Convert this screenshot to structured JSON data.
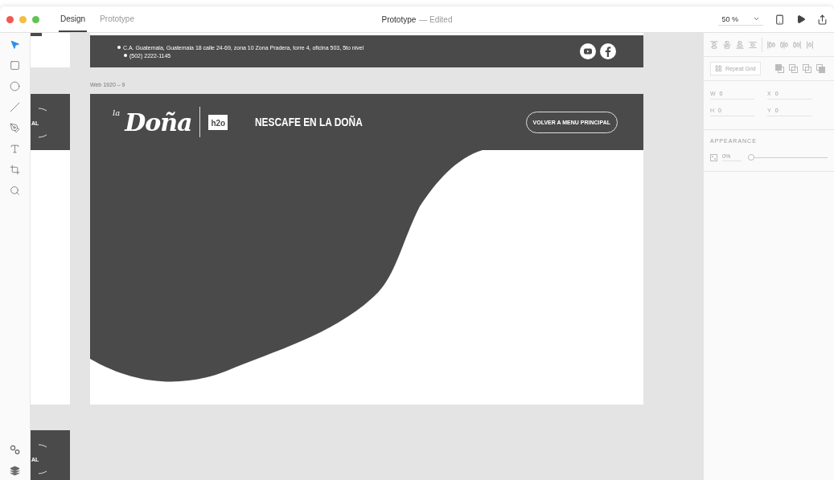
{
  "window": {
    "title": "Prototype",
    "status": "— Edited"
  },
  "mode_tabs": [
    {
      "label": "Design",
      "selected": true
    },
    {
      "label": "Prototype",
      "selected": false
    }
  ],
  "zoom": "50 %",
  "tools": [
    {
      "kind": "select",
      "selected": true
    },
    {
      "kind": "rectangle",
      "selected": false
    },
    {
      "kind": "ellipse",
      "selected": false
    },
    {
      "kind": "line",
      "selected": false
    },
    {
      "kind": "pen",
      "selected": false
    },
    {
      "kind": "text",
      "selected": false
    },
    {
      "kind": "artboard",
      "selected": false
    },
    {
      "kind": "zoom",
      "selected": false
    }
  ],
  "bottom_tools": [
    {
      "kind": "plugins"
    },
    {
      "kind": "layers"
    }
  ],
  "canvas": {
    "top_artboard": {
      "address": "C.A. Guatemala, Guatemala 18 calle 24-69, zona 10 Zona Pradera, torre 4, oficina 503, 5to nivel",
      "phone": "(502) 2222-1145"
    },
    "artboard": {
      "label": "Web 1920 – 9",
      "logo_small": "la",
      "logo": "Doña",
      "badge": "h2o",
      "heading": "NESCAFE EN LA DOÑA",
      "button": "VOLVER A MENU PRINCIPAL"
    },
    "side_artboards": [
      {
        "button_fragment": "AL"
      },
      {
        "button_fragment": "AL"
      }
    ]
  },
  "inspector": {
    "repeat_grid": "Repeat Grid",
    "fields": [
      {
        "label": "W",
        "value": "0"
      },
      {
        "label": "X",
        "value": "0"
      },
      {
        "label": "H",
        "value": "0"
      },
      {
        "label": "Y",
        "value": "0"
      }
    ],
    "appearance": "APPEARANCE",
    "opacity": {
      "value": "0%",
      "level": 0
    }
  }
}
